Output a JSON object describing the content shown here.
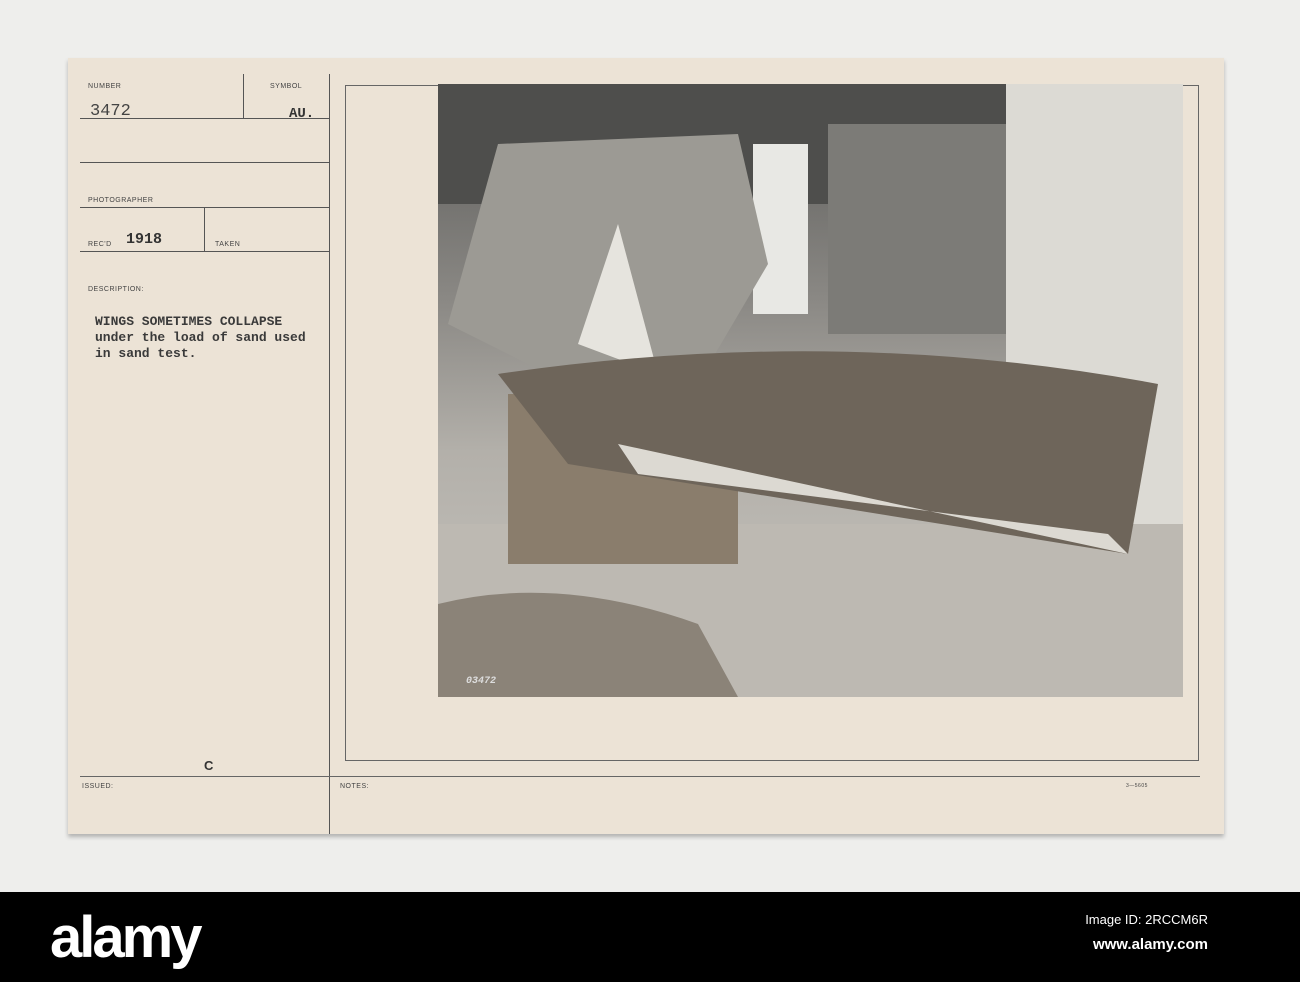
{
  "card": {
    "number_label": "NUMBER",
    "number": "3472",
    "symbol_label": "SYMBOL",
    "symbol": "AU.",
    "photographer_label": "PHOTOGRAPHER",
    "recd_label": "REC'D",
    "recd": "1918",
    "taken_label": "TAKEN",
    "description_label": "DESCRIPTION:",
    "description": [
      "WINGS SOMETIMES COLLAPSE",
      "under the load of sand used",
      "in sand test."
    ],
    "mark": "C",
    "issued_label": "ISSUED:",
    "notes_label": "NOTES:",
    "form_code": "3—5605",
    "photo_number": "03472"
  },
  "watermark": {
    "text": "alamy"
  },
  "footer": {
    "logo": "alamy",
    "image_id": "Image ID: 2RCCM6R",
    "url": "www.alamy.com"
  }
}
